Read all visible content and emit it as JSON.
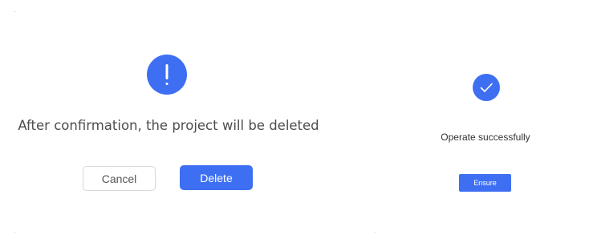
{
  "confirm_dialog": {
    "icon": "exclamation-icon",
    "message": "After confirmation, the project will be deleted",
    "cancel_label": "Cancel",
    "delete_label": "Delete"
  },
  "success_dialog": {
    "icon": "check-icon",
    "message": "Operate successfully",
    "ensure_label": "Ensure"
  },
  "colors": {
    "accent": "#3e6ff2",
    "message_text": "#4d4d4d",
    "cancel_border": "#d5d8dd",
    "background": "#ffffff"
  }
}
